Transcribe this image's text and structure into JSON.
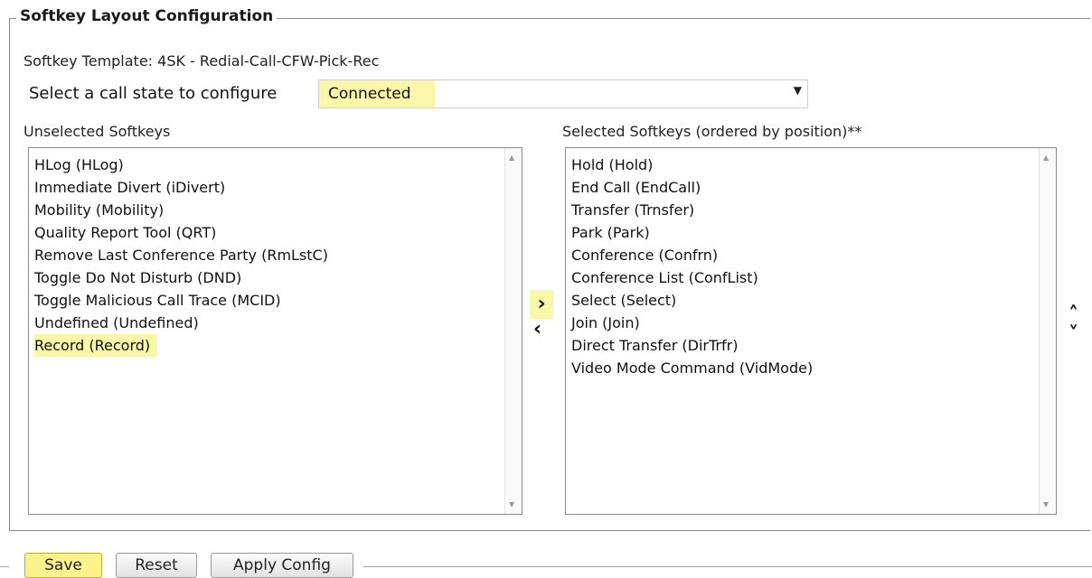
{
  "section": {
    "legend": "Softkey Layout Configuration",
    "template_label": "Softkey Template: 4SK - Redial-Call-CFW-Pick-Rec"
  },
  "call_state": {
    "label": "Select a call state to configure",
    "selected": "Connected"
  },
  "unselected": {
    "heading": "Unselected Softkeys",
    "items": [
      "HLog (HLog)",
      "Immediate Divert (iDivert)",
      "Mobility (Mobility)",
      "Quality Report Tool (QRT)",
      "Remove Last Conference Party (RmLstC)",
      "Toggle Do Not Disturb (DND)",
      "Toggle Malicious Call Trace (MCID)",
      "Undefined (Undefined)",
      "Record (Record)"
    ],
    "highlighted_index": 8
  },
  "selected": {
    "heading": "Selected Softkeys (ordered by position)**",
    "items": [
      "Hold (Hold)",
      "End Call (EndCall)",
      "Transfer (Trnsfer)",
      "Park (Park)",
      "Conference (Confrn)",
      "Conference List (ConfList)",
      "Select (Select)",
      "Join (Join)",
      "Direct Transfer (DirTrfr)",
      "Video Mode Command (VidMode)"
    ]
  },
  "controls": {
    "move_right": "›",
    "move_left": "‹",
    "order_up": "˄",
    "order_down": "˅"
  },
  "buttons": {
    "save": "Save",
    "reset": "Reset",
    "apply": "Apply Config"
  },
  "colors": {
    "highlight": "#fbf7a8"
  }
}
